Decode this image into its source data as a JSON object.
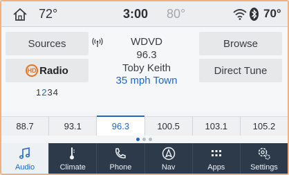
{
  "status": {
    "outside_temp": "72°",
    "time": "3:00",
    "inside_temp": "80°",
    "right_temp": "70°"
  },
  "audio": {
    "sources_label": "Sources",
    "hd_label": "Radio",
    "hd_badge": "HD",
    "presets_before": "1",
    "presets_current": "2",
    "presets_after": "34",
    "station_call": "WDVD",
    "station_freq": "96.3",
    "artist": "Toby Keith",
    "song": "35 mph Town",
    "browse_label": "Browse",
    "direct_tune_label": "Direct Tune"
  },
  "frequencies": [
    {
      "label": "88.7"
    },
    {
      "label": "93.1"
    },
    {
      "label": "96.3",
      "active": true
    },
    {
      "label": "100.5"
    },
    {
      "label": "103.1"
    },
    {
      "label": "105.2"
    }
  ],
  "page_indicator": {
    "pages": 3,
    "current": 1
  },
  "nav": [
    {
      "label": "Audio",
      "icon": "music-note-icon",
      "active": true
    },
    {
      "label": "Climate",
      "icon": "thermometer-icon"
    },
    {
      "label": "Phone",
      "icon": "phone-icon"
    },
    {
      "label": "Nav",
      "icon": "navigation-arrow-icon"
    },
    {
      "label": "Apps",
      "icon": "apps-grid-icon"
    },
    {
      "label": "Settings",
      "icon": "settings-gear-icon"
    }
  ],
  "colors": {
    "accent": "#1f66c9",
    "nav_bg": "#2d3a4a",
    "hd_orange": "#e8731c",
    "frame": "#f1b07e"
  }
}
